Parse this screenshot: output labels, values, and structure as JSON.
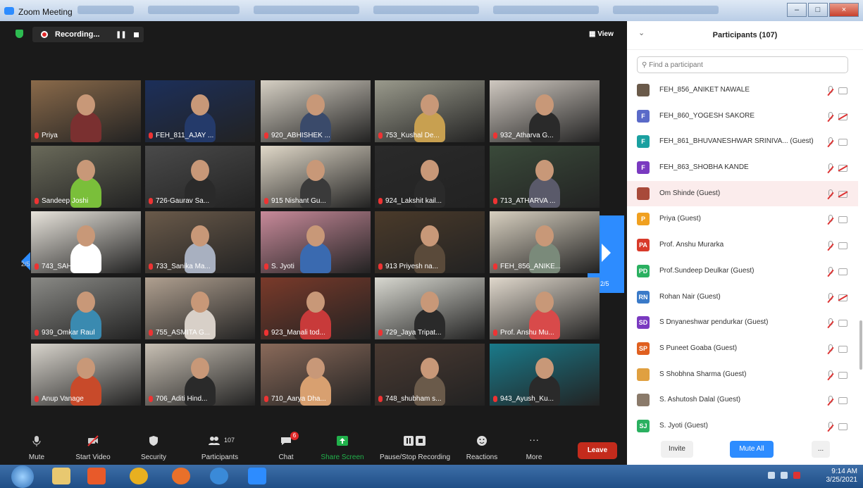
{
  "window": {
    "title": "Zoom Meeting",
    "controls": [
      "–",
      "□",
      "×"
    ]
  },
  "recording": {
    "label": "Recording...",
    "pause": "❚❚"
  },
  "view_button": "View",
  "pages": {
    "left": "2/5",
    "right": "2/5"
  },
  "tiles": [
    {
      "name": "Priya",
      "bg": "#8a6a4a",
      "shirt": "#7a3030"
    },
    {
      "name": "FEH_811_AJAY ...",
      "bg": "#1c2f5a",
      "shirt": "#243a6a"
    },
    {
      "name": "920_ABHISHEK ...",
      "bg": "#d6d0c4",
      "shirt": "#3a4a6a"
    },
    {
      "name": "753_Kushal De...",
      "bg": "#9a9a8c",
      "shirt": "#c8a050"
    },
    {
      "name": "932_Atharva G...",
      "bg": "#cfc8c0",
      "shirt": "#2a2a2a"
    },
    {
      "name": "Sandeep Joshi",
      "bg": "#6a6a5a",
      "shirt": "#7abf3a"
    },
    {
      "name": "726-Gaurav Sa...",
      "bg": "#4a4a4a",
      "shirt": "#2a2a2a"
    },
    {
      "name": "915 Nishant Gu...",
      "bg": "#e0d8c8",
      "shirt": "#3a3a3a"
    },
    {
      "name": "924_Lakshit kail...",
      "bg": "#2a2a2a",
      "shirt": "#2a2a2a"
    },
    {
      "name": "713_ATHARVA ...",
      "bg": "#3a4a3a",
      "shirt": "#5a5a6a"
    },
    {
      "name": "743_SAHIL LAL...",
      "bg": "#e8e4dc",
      "shirt": "#ffffff"
    },
    {
      "name": "733_Sanika Ma...",
      "bg": "#6a5a4a",
      "shirt": "#a8b0c0"
    },
    {
      "name": "S. Jyoti",
      "bg": "#c88a9a",
      "shirt": "#3a6ab0"
    },
    {
      "name": "913 Priyesh na...",
      "bg": "#4a3a2a",
      "shirt": "#5a4a3a"
    },
    {
      "name": "FEH_856_ANIKE...",
      "bg": "#d8d0c0",
      "shirt": "#7a8a7a"
    },
    {
      "name": "939_Omkar Raul",
      "bg": "#8a8a86",
      "shirt": "#3a8ab0"
    },
    {
      "name": "755_ASMITA G...",
      "bg": "#b0a090",
      "shirt": "#d8d0c8"
    },
    {
      "name": "923_Manali tod...",
      "bg": "#7a3a2a",
      "shirt": "#c83a3a"
    },
    {
      "name": "729_Jaya Tripat...",
      "bg": "#d8d8d0",
      "shirt": "#2a2a2a"
    },
    {
      "name": "Prof. Anshu Mu...",
      "bg": "#e0d8cc",
      "shirt": "#d84a4a"
    },
    {
      "name": "Anup Vanage",
      "bg": "#d8d4cc",
      "shirt": "#c84a2a"
    },
    {
      "name": "706_Aditi Hind...",
      "bg": "#c8c0b4",
      "shirt": "#2a2a2a"
    },
    {
      "name": "710_Aarya Dha...",
      "bg": "#8a6a5a",
      "shirt": "#d8a070"
    },
    {
      "name": "748_shubham s...",
      "bg": "#4a3a32",
      "shirt": "#6a5a4a"
    },
    {
      "name": "943_Ayush_Ku...",
      "bg": "#1a7a8a",
      "shirt": "#2a2a2a"
    }
  ],
  "toolbar": {
    "mute": "Mute",
    "start_video": "Start Video",
    "security": "Security",
    "participants": "Participants",
    "participant_count": "107",
    "chat": "Chat",
    "chat_badge": "6",
    "share_screen": "Share Screen",
    "pause_stop": "Pause/Stop Recording",
    "reactions": "Reactions",
    "more": "More",
    "leave": "Leave"
  },
  "panel": {
    "title": "Participants (107)",
    "search_placeholder": "Find a participant",
    "participants": [
      {
        "initials": "",
        "name": "FEH_856_ANIKET NAWALE",
        "color": "#6a5a4a",
        "cam_off": false,
        "hl": false
      },
      {
        "initials": "F",
        "name": "FEH_860_YOGESH SAKORE",
        "color": "#5a6ac8",
        "cam_off": true,
        "hl": false
      },
      {
        "initials": "F",
        "name": "FEH_861_BHUVANESHWAR SRINIVA... (Guest)",
        "color": "#1aa0a0",
        "cam_off": false,
        "hl": false
      },
      {
        "initials": "F",
        "name": "FEH_863_SHOBHA KANDE",
        "color": "#7a3ac0",
        "cam_off": true,
        "hl": false
      },
      {
        "initials": "",
        "name": "Om Shinde (Guest)",
        "color": "#a84a3a",
        "cam_off": true,
        "hl": true
      },
      {
        "initials": "P",
        "name": "Priya (Guest)",
        "color": "#f0a020",
        "cam_off": false,
        "hl": false
      },
      {
        "initials": "PA",
        "name": "Prof. Anshu Murarka",
        "color": "#d83a2a",
        "cam_off": false,
        "hl": false
      },
      {
        "initials": "PD",
        "name": "Prof.Sundeep Deulkar (Guest)",
        "color": "#2ab060",
        "cam_off": false,
        "hl": false
      },
      {
        "initials": "RN",
        "name": "Rohan Nair (Guest)",
        "color": "#3a7ac8",
        "cam_off": true,
        "hl": false
      },
      {
        "initials": "SD",
        "name": "S Dnyaneshwar pendurkar (Guest)",
        "color": "#7a3ac0",
        "cam_off": false,
        "hl": false
      },
      {
        "initials": "SP",
        "name": "S Puneet Goaba (Guest)",
        "color": "#e06020",
        "cam_off": false,
        "hl": false
      },
      {
        "initials": "",
        "name": "S Shobhna Sharma (Guest)",
        "color": "#e0a040",
        "cam_off": false,
        "hl": false
      },
      {
        "initials": "",
        "name": "S. Ashutosh Dalal (Guest)",
        "color": "#8a7a6a",
        "cam_off": false,
        "hl": false
      },
      {
        "initials": "SJ",
        "name": "S. Jyoti (Guest)",
        "color": "#2ab060",
        "cam_off": false,
        "hl": false
      }
    ],
    "invite": "Invite",
    "mute_all": "Mute All",
    "more": "..."
  },
  "taskbar": {
    "time": "9:14 AM",
    "date": "3/25/2021"
  }
}
